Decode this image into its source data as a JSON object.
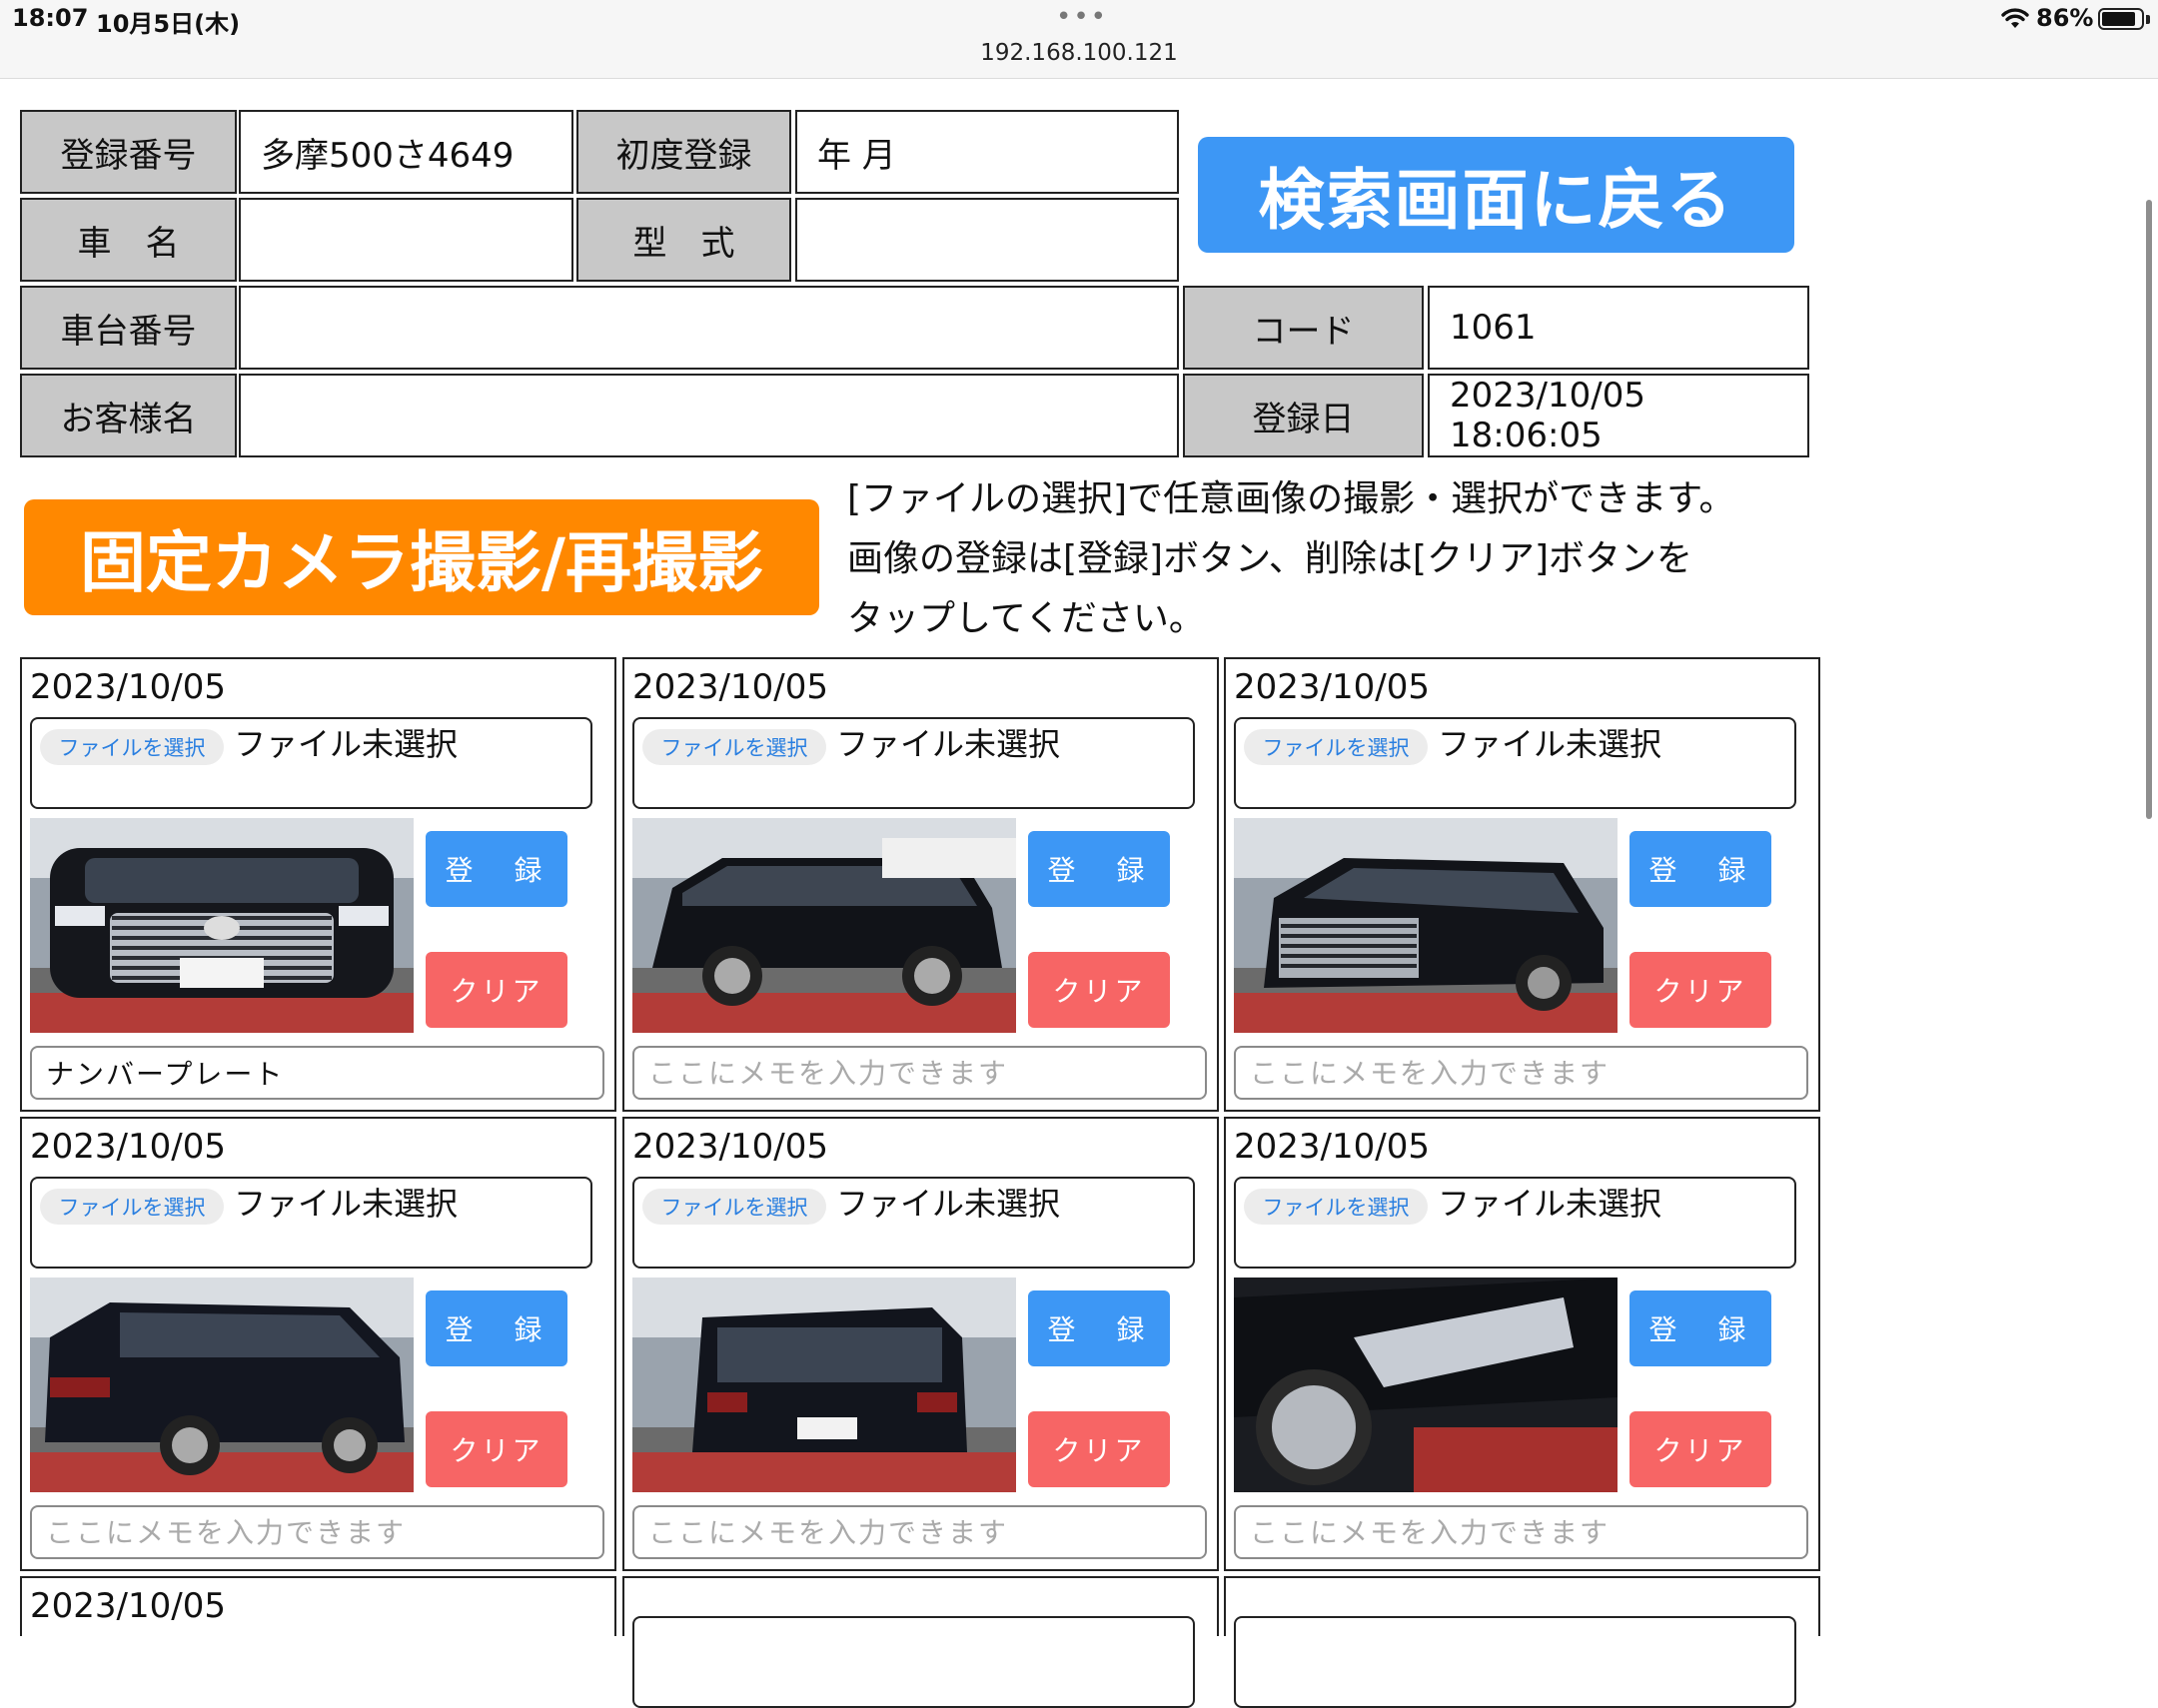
{
  "status_bar": {
    "time": "18:07",
    "date": "10月5日(木)",
    "url": "192.168.100.121",
    "battery": "86%",
    "battery_level": 0.86
  },
  "vehicle": {
    "reg_no_label": "登録番号",
    "reg_no_value": "多摩500さ4649",
    "first_reg_label": "初度登録",
    "first_reg_value": "年 月",
    "car_name_label": "車　名",
    "car_name_value": "",
    "model_label": "型　式",
    "model_value": "",
    "chassis_label": "車台番号",
    "chassis_value": "",
    "code_label": "コード",
    "code_value": "1061",
    "customer_label": "お客様名",
    "customer_value": "",
    "reg_date_label": "登録日",
    "reg_date_value": "2023/10/05 18:06:05"
  },
  "actions": {
    "back_label": "検索画面に戻る",
    "camera_label": "固定カメラ撮影/再撮影"
  },
  "instructions": [
    "[ファイルの選択]で任意画像の撮影・選択ができます。",
    "画像の登録は[登録]ボタン、削除は[クリア]ボタンを",
    "タップしてください。"
  ],
  "photos": [
    {
      "date": "2023/10/05",
      "file_button": "ファイルを選択",
      "file_status": "ファイル未選択",
      "register_label": "登 録",
      "clear_label": "クリア",
      "memo_value": "ナンバープレート",
      "memo_placeholder": "ここにメモを入力できます",
      "view": "front"
    },
    {
      "date": "2023/10/05",
      "file_button": "ファイルを選択",
      "file_status": "ファイル未選択",
      "register_label": "登 録",
      "clear_label": "クリア",
      "memo_value": "",
      "memo_placeholder": "ここにメモを入力できます",
      "view": "side-left"
    },
    {
      "date": "2023/10/05",
      "file_button": "ファイルを選択",
      "file_status": "ファイル未選択",
      "register_label": "登 録",
      "clear_label": "クリア",
      "memo_value": "",
      "memo_placeholder": "ここにメモを入力できます",
      "view": "front-angle"
    },
    {
      "date": "2023/10/05",
      "file_button": "ファイルを選択",
      "file_status": "ファイル未選択",
      "register_label": "登 録",
      "clear_label": "クリア",
      "memo_value": "",
      "memo_placeholder": "ここにメモを入力できます",
      "view": "rear-angle"
    },
    {
      "date": "2023/10/05",
      "file_button": "ファイルを選択",
      "file_status": "ファイル未選択",
      "register_label": "登 録",
      "clear_label": "クリア",
      "memo_value": "",
      "memo_placeholder": "ここにメモを入力できます",
      "view": "rear"
    },
    {
      "date": "2023/10/05",
      "file_button": "ファイルを選択",
      "file_status": "ファイル未選択",
      "register_label": "登 録",
      "clear_label": "クリア",
      "memo_value": "",
      "memo_placeholder": "ここにメモを入力できます",
      "view": "headlight"
    }
  ],
  "next_row_date": "2023/10/05",
  "colors": {
    "label_bg": "#c8c8c8",
    "blue_button": "#3d97f5",
    "orange_button": "#ff8800",
    "clear_button": "#f76565"
  }
}
